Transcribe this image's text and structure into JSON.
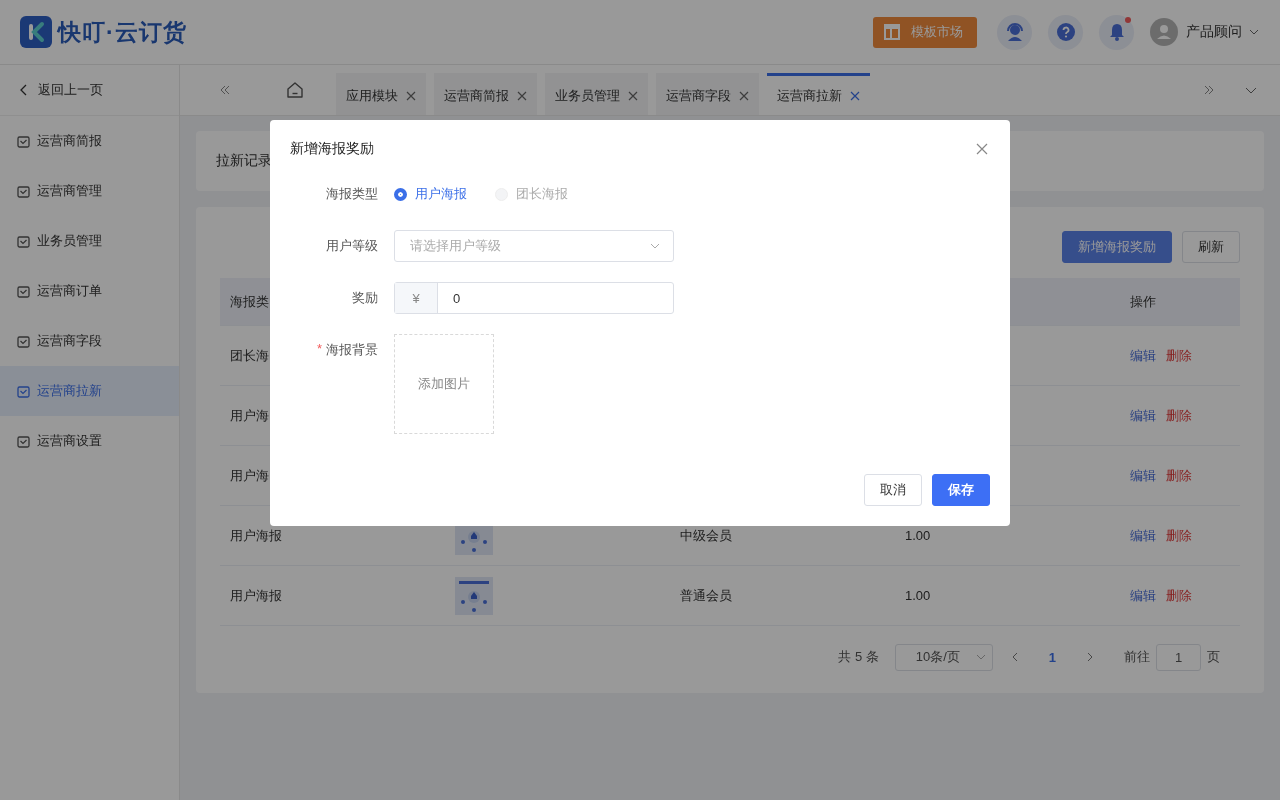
{
  "header": {
    "logo": "快叮·云订货",
    "market_button": "模板市场",
    "notification_dot": true,
    "user": "产品顾问"
  },
  "sidebar": {
    "back": "返回上一页",
    "items": [
      {
        "label": "运营商简报",
        "selected": false
      },
      {
        "label": "运营商管理",
        "selected": false
      },
      {
        "label": "业务员管理",
        "selected": false
      },
      {
        "label": "运营商订单",
        "selected": false
      },
      {
        "label": "运营商字段",
        "selected": false
      },
      {
        "label": "运营商拉新",
        "selected": true
      },
      {
        "label": "运营商设置",
        "selected": false
      }
    ]
  },
  "tabs": [
    {
      "label": "应用模块",
      "selected": false
    },
    {
      "label": "运营商简报",
      "selected": false
    },
    {
      "label": "业务员管理",
      "selected": false
    },
    {
      "label": "运营商字段",
      "selected": false
    },
    {
      "label": "运营商拉新",
      "selected": true
    }
  ],
  "record_card": {
    "title": "拉新记录"
  },
  "toolbar": {
    "buttons": [
      {
        "label": "新增海报奖励",
        "kind": "primary"
      },
      {
        "label": "刷新",
        "kind": "default"
      }
    ]
  },
  "table": {
    "columns": {
      "type": "海报类",
      "actions": "操作"
    },
    "rows": [
      {
        "type": "团长海",
        "actions": [
          {
            "label": "编辑",
            "kind": "edit"
          },
          {
            "label": "删除",
            "kind": "delete"
          }
        ]
      },
      {
        "type": "用户海",
        "actions": [
          {
            "label": "编辑",
            "kind": "edit"
          },
          {
            "label": "删除",
            "kind": "delete"
          }
        ]
      },
      {
        "type": "用户海",
        "actions": [
          {
            "label": "编辑",
            "kind": "edit"
          },
          {
            "label": "删除",
            "kind": "delete"
          }
        ]
      },
      {
        "type": "用户海报",
        "level": "中级会员",
        "reward": "1.00",
        "actions": [
          {
            "label": "编辑",
            "kind": "edit"
          },
          {
            "label": "删除",
            "kind": "delete"
          }
        ]
      },
      {
        "type": "用户海报",
        "level": "普通会员",
        "reward": "1.00",
        "actions": [
          {
            "label": "编辑",
            "kind": "edit"
          },
          {
            "label": "删除",
            "kind": "delete"
          }
        ]
      }
    ]
  },
  "pagination": {
    "total": "共 5 条",
    "page_size": "10条/页",
    "pages": [
      {
        "label": "1",
        "selected": true
      }
    ],
    "goto_label": "前往",
    "goto_value": "1",
    "goto_suffix": "页"
  },
  "dialog": {
    "title": "新增海报奖励",
    "fields": [
      {
        "kind": "radio",
        "label": "海报类型",
        "options": [
          {
            "label": "用户海报",
            "selected": true,
            "disabled": false
          },
          {
            "label": "团长海报",
            "selected": false,
            "disabled": true
          }
        ]
      },
      {
        "kind": "select",
        "label": "用户等级",
        "placeholder": "请选择用户等级"
      },
      {
        "kind": "money",
        "label": "奖励",
        "prefix": "¥",
        "value": "0"
      },
      {
        "kind": "upload",
        "label": "海报背景",
        "required_mark": "*",
        "text": "添加图片"
      }
    ],
    "buttons": [
      {
        "label": "取消",
        "kind": "default"
      },
      {
        "label": "保存",
        "kind": "primary"
      }
    ]
  }
}
